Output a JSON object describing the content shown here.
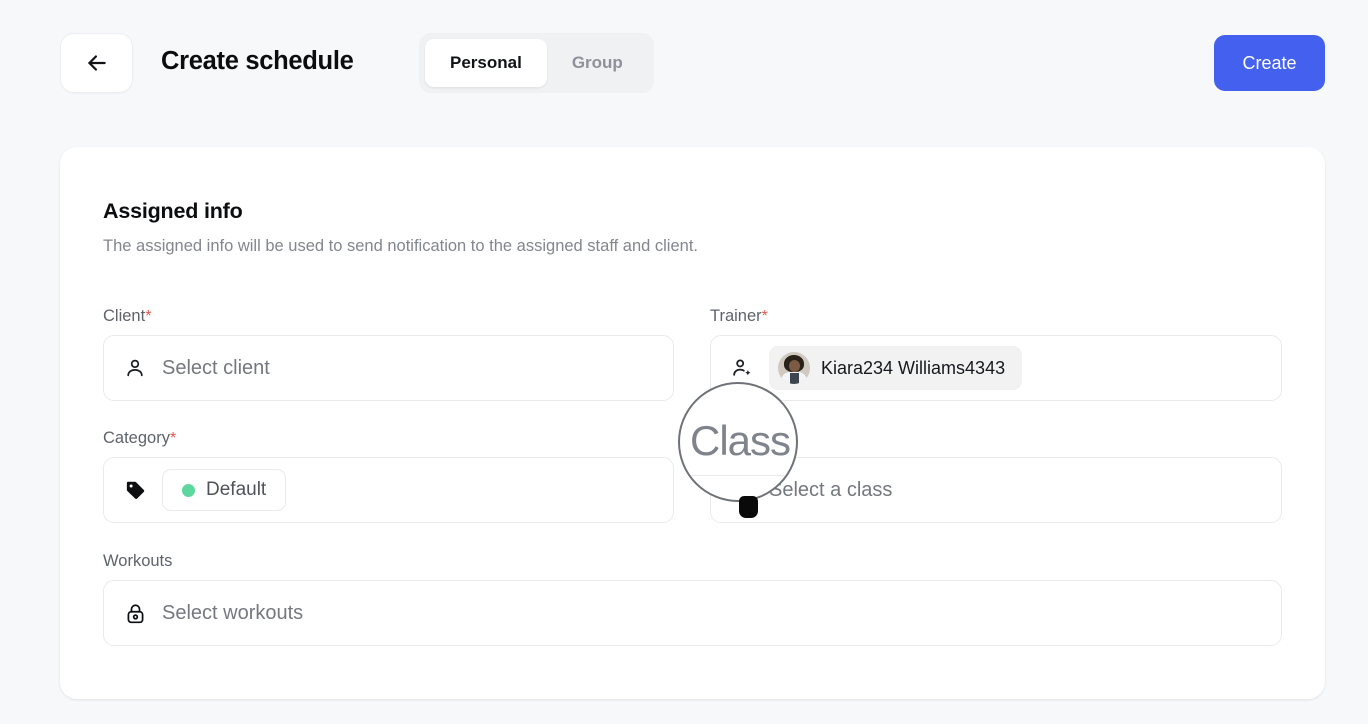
{
  "header": {
    "back_icon": "arrow-left-icon",
    "title": "Create schedule",
    "tabs": [
      {
        "label": "Personal",
        "active": true
      },
      {
        "label": "Group",
        "active": false
      }
    ],
    "create_label": "Create",
    "create_color": "#4361ee"
  },
  "card": {
    "section_title": "Assigned info",
    "section_subtitle": "The assigned info will be used to send notification to the assigned staff and client.",
    "fields": {
      "client": {
        "label": "Client",
        "required": true,
        "required_mark": "*",
        "icon": "person-icon",
        "placeholder": "Select client",
        "value": ""
      },
      "trainer": {
        "label": "Trainer",
        "required": true,
        "required_mark": "*",
        "icon": "person-add-icon",
        "placeholder": "",
        "chip_name": "Kiara234 Williams4343",
        "avatar": "trainer-avatar"
      },
      "category": {
        "label": "Category",
        "required": true,
        "required_mark": "*",
        "icon": "tag-icon",
        "chip_name": "Default",
        "chip_dot_color": "#5ed79f"
      },
      "class": {
        "label": "Class",
        "required": false,
        "icon": "cube-icon",
        "placeholder": "Select a class",
        "value": ""
      },
      "workouts": {
        "label": "Workouts",
        "required": false,
        "icon": "lock-icon",
        "placeholder": "Select workouts",
        "value": ""
      }
    }
  },
  "overlay": {
    "magnifier_text": "Class",
    "cursor": "pointer-cursor"
  }
}
